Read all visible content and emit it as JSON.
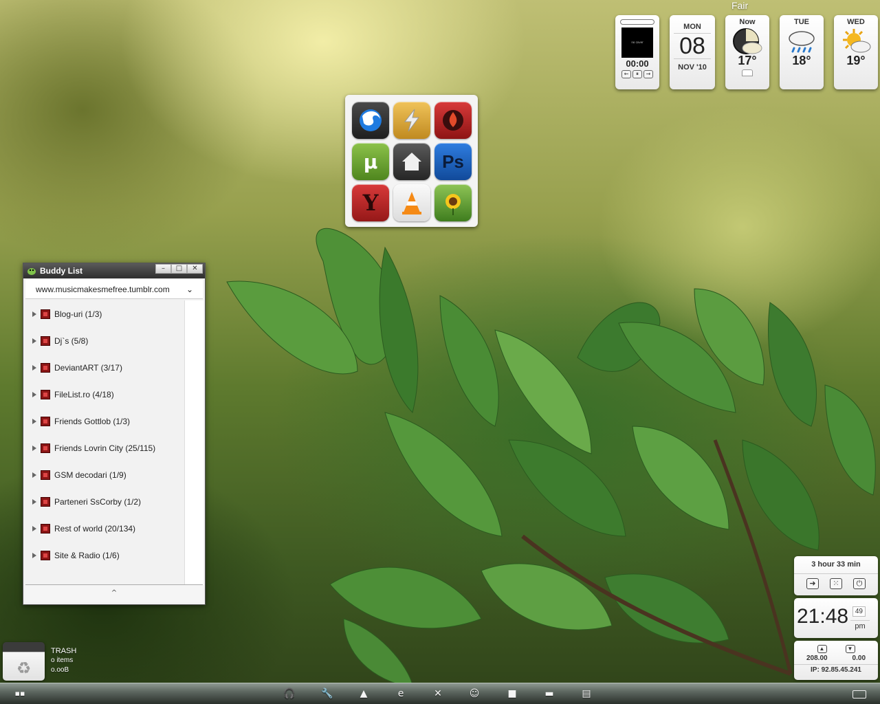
{
  "desktop": {
    "weather_condition": "Fair"
  },
  "media_player": {
    "cover_text": "no cover",
    "time": "00:00",
    "controls": [
      "←",
      "⏸",
      "→"
    ]
  },
  "date_widget": {
    "day": "MON",
    "date": "08",
    "month_year": "NOV '10"
  },
  "weather": [
    {
      "day": "Now",
      "temp": "17°",
      "icon": "partly-cloudy-night-icon"
    },
    {
      "day": "TUE",
      "temp": "18°",
      "icon": "rain-cloud-icon"
    },
    {
      "day": "WED",
      "temp": "19°",
      "icon": "sun-cloud-icon"
    }
  ],
  "launcher": {
    "apps": [
      {
        "name": "firefox-icon",
        "color": "#2a2a2a"
      },
      {
        "name": "winamp-icon",
        "color": "#d4a43a"
      },
      {
        "name": "burner-icon",
        "color": "#b82323"
      },
      {
        "name": "utorrent-icon",
        "color": "#6fa12e"
      },
      {
        "name": "home-icon",
        "color": "#3a3a3a"
      },
      {
        "name": "photoshop-icon",
        "color": "#1c5fb8"
      },
      {
        "name": "yahoo-icon",
        "color": "#c42626"
      },
      {
        "name": "vlc-icon",
        "color": "#ededed"
      },
      {
        "name": "sunflower-icon",
        "color": "#5a9a2a"
      }
    ],
    "labels": {
      "photoshop": "Ps",
      "yahoo": "Y",
      "utorrent": "µ"
    }
  },
  "buddy_list": {
    "title": "Buddy List",
    "account": "www.musicmakesmefree.tumblr.com",
    "window_buttons": [
      "–",
      "□",
      "✕"
    ],
    "groups": [
      "Blog-uri (1/3)",
      "Dj`s (5/8)",
      "DeviantART (3/17)",
      "FileList.ro (4/18)",
      "Friends  Gottlob (1/3)",
      "Friends Lovrin City (25/115)",
      "GSM decodari (1/9)",
      "Parteneri SsCorby (1/2)",
      "Rest of world (20/134)",
      "Site & Radio (1/6)"
    ],
    "footer_glyph": "^"
  },
  "trash": {
    "label": "TRASH",
    "items": "o items",
    "size": "o.ooB",
    "icon": "recycle-icon"
  },
  "battery": {
    "remaining": "3 hour 33 min"
  },
  "clock": {
    "time": "21:48",
    "seconds": "49",
    "ampm": "pm"
  },
  "network": {
    "upload": "208.00",
    "download": "0.00",
    "ip": "IP: 92.85.45.241"
  },
  "taskbar": {
    "icons": [
      {
        "name": "headphones-icon",
        "glyph": "🎧"
      },
      {
        "name": "wrench-icon",
        "glyph": "🔧"
      },
      {
        "name": "bell-icon",
        "glyph": "▲"
      },
      {
        "name": "ie-icon",
        "glyph": "e"
      },
      {
        "name": "close-icon",
        "glyph": "✕"
      },
      {
        "name": "pidgin-icon",
        "glyph": "☺"
      },
      {
        "name": "video-icon",
        "glyph": "■"
      },
      {
        "name": "clapper-icon",
        "glyph": "▬"
      },
      {
        "name": "folder-icon",
        "glyph": "▤"
      }
    ]
  }
}
